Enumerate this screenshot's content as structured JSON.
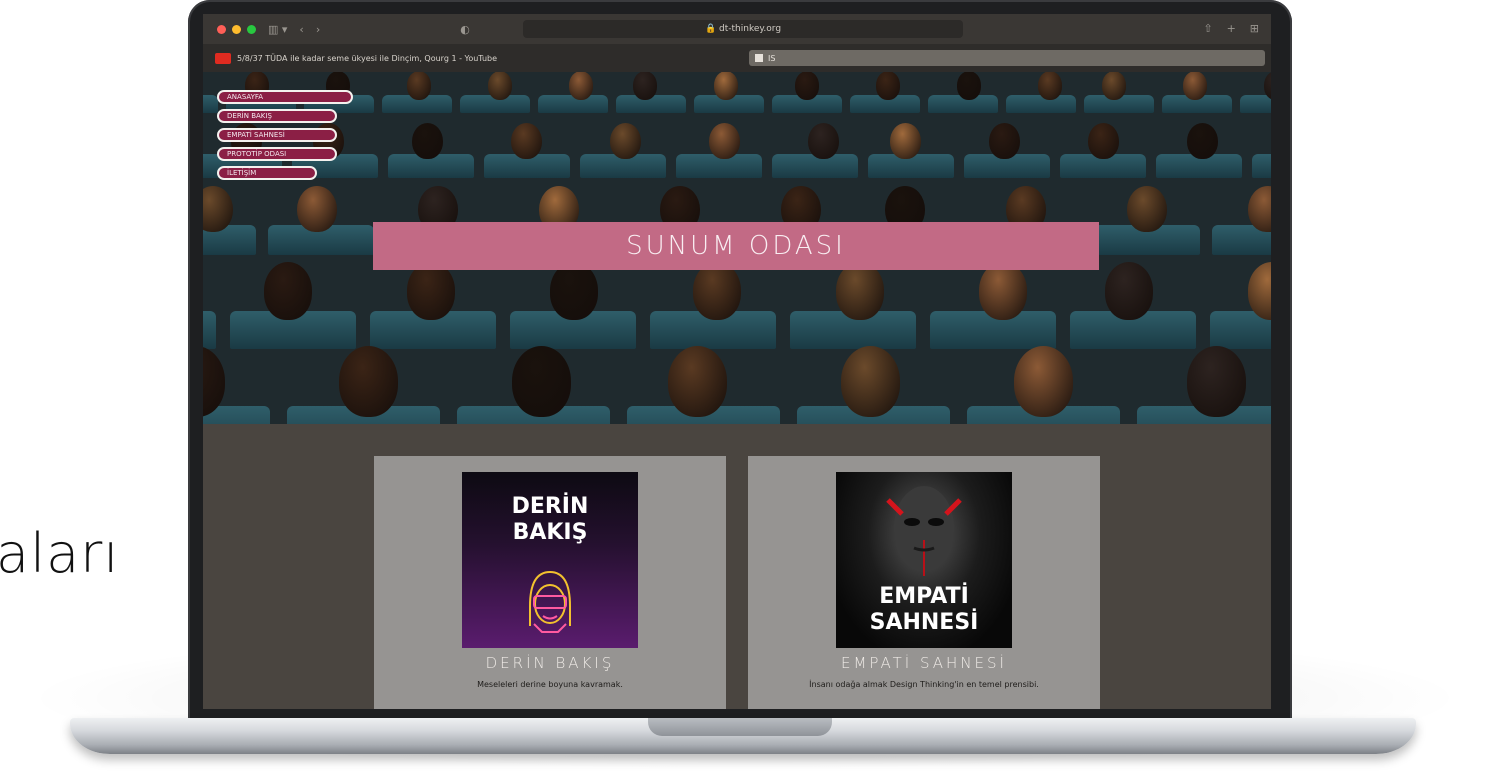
{
  "slide": {
    "side_text": "aları"
  },
  "browser": {
    "url": "🔒 dt-thinkey.org",
    "tab_title": "5/8/37 TÜDA ile kadar seme ükyesi ile Dinçim, Qourg 1 - YouTube",
    "second_tab": "IS",
    "icons": [
      "sidebar-icon",
      "back-icon",
      "forward-icon",
      "privacy-icon",
      "share-icon",
      "new-tab-icon",
      "grid-icon"
    ]
  },
  "menu": {
    "items": [
      "ANASAYFA",
      "DERİN BAKIŞ",
      "EMPATİ SAHNESİ",
      "PROTOTİP ODASI",
      "İLETİŞİM"
    ]
  },
  "hero": {
    "banner": "SUNUM ODASI"
  },
  "cards": [
    {
      "image_text_1": "DERİN",
      "image_text_2": "BAKIŞ",
      "title": "DERİN BAKIŞ",
      "description": "Meseleleri derine boyuna kavramak."
    },
    {
      "image_text_1": "EMPATİ",
      "image_text_2": "SAHNESİ",
      "title": "EMPATİ SAHNESİ",
      "description": "İnsanı odağa almak Design Thinking'in en temel prensibi."
    }
  ],
  "colors": {
    "menu_bg": "#8b1f45",
    "banner_bg": "#c26a85",
    "card_bg": "#969492",
    "page_bg": "#4a4540"
  }
}
